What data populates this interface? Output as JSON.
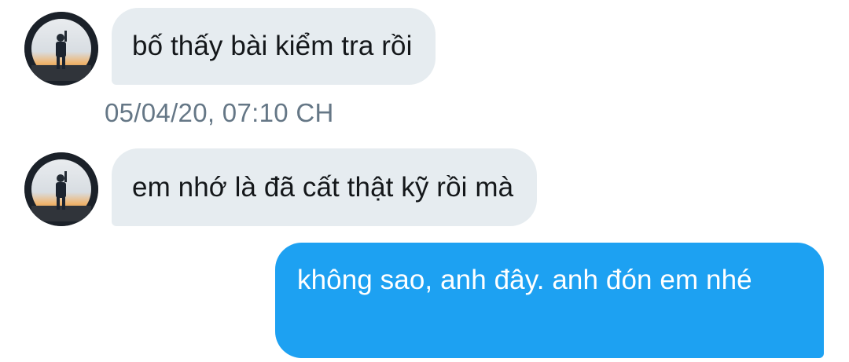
{
  "messages": [
    {
      "direction": "incoming",
      "text": "bố thấy bài kiểm tra rồi",
      "timestamp": "05/04/20, 07:10 CH"
    },
    {
      "direction": "incoming",
      "text": "em nhớ là đã cất thật kỹ rồi mà"
    },
    {
      "direction": "outgoing",
      "text": "không sao, anh đây. anh đón em nhé"
    }
  ],
  "colors": {
    "incoming_bubble": "#e6ecf0",
    "outgoing_bubble": "#1da1f2",
    "timestamp": "#657786"
  },
  "icons": {
    "avatar": "user-photo-avatar"
  }
}
